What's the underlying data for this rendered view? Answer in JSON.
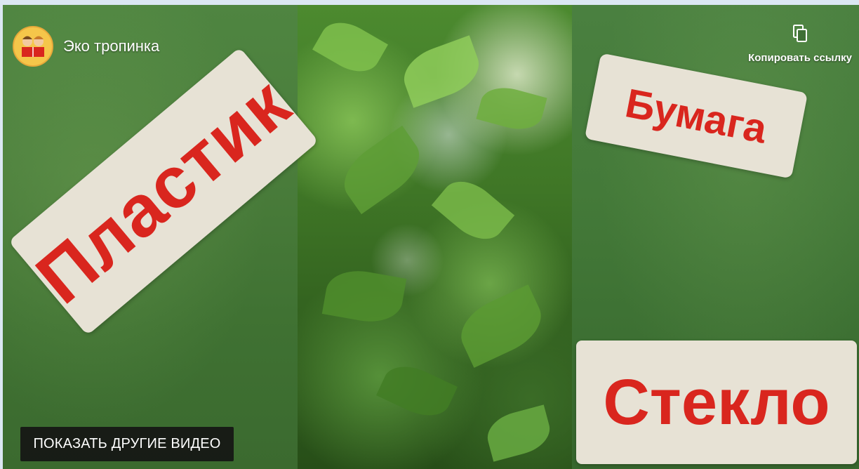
{
  "channel": {
    "name": "Эко тропинка",
    "avatar_icon": "kids-reading-book-icon"
  },
  "actions": {
    "copy_link_label": "Копировать ссылку",
    "copy_icon": "copy-icon"
  },
  "video_cards": {
    "plastic": "Пластик",
    "paper": "Бумага",
    "glass": "Стекло"
  },
  "more_videos_label": "ПОКАЗАТЬ ДРУГИЕ ВИДЕО",
  "colors": {
    "card_text": "#d9261e",
    "card_bg": "#e7e2d5",
    "background_green": "#3f6f35"
  }
}
